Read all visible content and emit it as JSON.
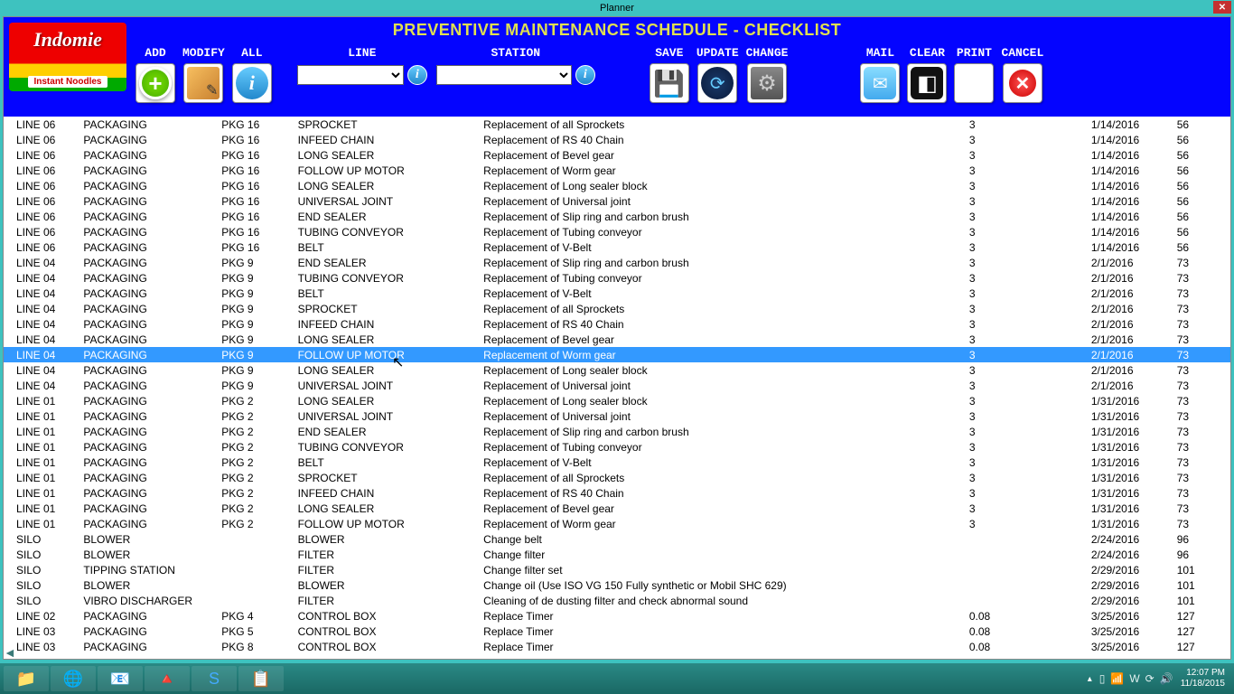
{
  "window": {
    "title": "Planner"
  },
  "header": {
    "title": "PREVENTIVE MAINTENANCE SCHEDULE - CHECKLIST"
  },
  "logo": {
    "brand": "Indomie",
    "tagline": "Instant Noodles"
  },
  "toolbar": {
    "add": "ADD",
    "modify": "MODIFY",
    "all": "ALL",
    "line": "LINE",
    "station": "STATION",
    "save": "SAVE",
    "update": "UPDATE",
    "change": "CHANGE",
    "mail": "MAIL",
    "clear": "CLEAR",
    "print": "PRINT",
    "cancel": "CANCEL"
  },
  "rows": [
    {
      "line": "LINE 06",
      "area": "PACKAGING",
      "code": "PKG 16",
      "part": "SPROCKET",
      "desc": "Replacement of all Sprockets",
      "qty": "3",
      "date": "1/14/2016",
      "days": "56"
    },
    {
      "line": "LINE 06",
      "area": "PACKAGING",
      "code": "PKG 16",
      "part": "INFEED CHAIN",
      "desc": "Replacement of RS 40 Chain",
      "qty": "3",
      "date": "1/14/2016",
      "days": "56"
    },
    {
      "line": "LINE 06",
      "area": "PACKAGING",
      "code": "PKG 16",
      "part": "LONG SEALER",
      "desc": "Replacement of Bevel gear",
      "qty": "3",
      "date": "1/14/2016",
      "days": "56"
    },
    {
      "line": "LINE 06",
      "area": "PACKAGING",
      "code": "PKG 16",
      "part": "FOLLOW UP MOTOR",
      "desc": "Replacement of Worm gear",
      "qty": "3",
      "date": "1/14/2016",
      "days": "56"
    },
    {
      "line": "LINE 06",
      "area": "PACKAGING",
      "code": "PKG 16",
      "part": "LONG SEALER",
      "desc": "Replacement of Long sealer block",
      "qty": "3",
      "date": "1/14/2016",
      "days": "56"
    },
    {
      "line": "LINE 06",
      "area": "PACKAGING",
      "code": "PKG 16",
      "part": "UNIVERSAL JOINT",
      "desc": "Replacement of Universal joint",
      "qty": "3",
      "date": "1/14/2016",
      "days": "56"
    },
    {
      "line": "LINE 06",
      "area": "PACKAGING",
      "code": "PKG 16",
      "part": "END SEALER",
      "desc": "Replacement of Slip ring and carbon brush",
      "qty": "3",
      "date": "1/14/2016",
      "days": "56"
    },
    {
      "line": "LINE 06",
      "area": "PACKAGING",
      "code": "PKG 16",
      "part": "TUBING CONVEYOR",
      "desc": "Replacement of Tubing conveyor",
      "qty": "3",
      "date": "1/14/2016",
      "days": "56"
    },
    {
      "line": "LINE 06",
      "area": "PACKAGING",
      "code": "PKG 16",
      "part": "BELT",
      "desc": "Replacement of V-Belt",
      "qty": "3",
      "date": "1/14/2016",
      "days": "56"
    },
    {
      "line": "LINE 04",
      "area": "PACKAGING",
      "code": "PKG 9",
      "part": "END SEALER",
      "desc": "Replacement of Slip ring and carbon brush",
      "qty": "3",
      "date": "2/1/2016",
      "days": "73"
    },
    {
      "line": "LINE 04",
      "area": "PACKAGING",
      "code": "PKG 9",
      "part": "TUBING CONVEYOR",
      "desc": "Replacement of Tubing conveyor",
      "qty": "3",
      "date": "2/1/2016",
      "days": "73"
    },
    {
      "line": "LINE 04",
      "area": "PACKAGING",
      "code": "PKG 9",
      "part": "BELT",
      "desc": "Replacement of V-Belt",
      "qty": "3",
      "date": "2/1/2016",
      "days": "73"
    },
    {
      "line": "LINE 04",
      "area": "PACKAGING",
      "code": "PKG 9",
      "part": "SPROCKET",
      "desc": "Replacement of all Sprockets",
      "qty": "3",
      "date": "2/1/2016",
      "days": "73"
    },
    {
      "line": "LINE 04",
      "area": "PACKAGING",
      "code": "PKG 9",
      "part": "INFEED CHAIN",
      "desc": "Replacement of RS 40 Chain",
      "qty": "3",
      "date": "2/1/2016",
      "days": "73"
    },
    {
      "line": "LINE 04",
      "area": "PACKAGING",
      "code": "PKG 9",
      "part": "LONG SEALER",
      "desc": "Replacement of Bevel gear",
      "qty": "3",
      "date": "2/1/2016",
      "days": "73"
    },
    {
      "line": "LINE 04",
      "area": "PACKAGING",
      "code": "PKG 9",
      "part": "FOLLOW UP MOTOR",
      "desc": "Replacement of Worm gear",
      "qty": "3",
      "date": "2/1/2016",
      "days": "73",
      "sel": true
    },
    {
      "line": "LINE 04",
      "area": "PACKAGING",
      "code": "PKG 9",
      "part": "LONG SEALER",
      "desc": "Replacement of Long sealer block",
      "qty": "3",
      "date": "2/1/2016",
      "days": "73"
    },
    {
      "line": "LINE 04",
      "area": "PACKAGING",
      "code": "PKG 9",
      "part": "UNIVERSAL JOINT",
      "desc": "Replacement of Universal joint",
      "qty": "3",
      "date": "2/1/2016",
      "days": "73"
    },
    {
      "line": "LINE 01",
      "area": "PACKAGING",
      "code": "PKG 2",
      "part": "LONG SEALER",
      "desc": "Replacement of Long sealer block",
      "qty": "3",
      "date": "1/31/2016",
      "days": "73"
    },
    {
      "line": "LINE 01",
      "area": "PACKAGING",
      "code": "PKG 2",
      "part": "UNIVERSAL JOINT",
      "desc": "Replacement of Universal joint",
      "qty": "3",
      "date": "1/31/2016",
      "days": "73"
    },
    {
      "line": "LINE 01",
      "area": "PACKAGING",
      "code": "PKG 2",
      "part": "END SEALER",
      "desc": "Replacement of Slip ring and carbon brush",
      "qty": "3",
      "date": "1/31/2016",
      "days": "73"
    },
    {
      "line": "LINE 01",
      "area": "PACKAGING",
      "code": "PKG 2",
      "part": "TUBING CONVEYOR",
      "desc": "Replacement of Tubing conveyor",
      "qty": "3",
      "date": "1/31/2016",
      "days": "73"
    },
    {
      "line": "LINE 01",
      "area": "PACKAGING",
      "code": "PKG 2",
      "part": "BELT",
      "desc": "Replacement of V-Belt",
      "qty": "3",
      "date": "1/31/2016",
      "days": "73"
    },
    {
      "line": "LINE 01",
      "area": "PACKAGING",
      "code": "PKG 2",
      "part": "SPROCKET",
      "desc": "Replacement of all Sprockets",
      "qty": "3",
      "date": "1/31/2016",
      "days": "73"
    },
    {
      "line": "LINE 01",
      "area": "PACKAGING",
      "code": "PKG 2",
      "part": "INFEED CHAIN",
      "desc": "Replacement of RS 40 Chain",
      "qty": "3",
      "date": "1/31/2016",
      "days": "73"
    },
    {
      "line": "LINE 01",
      "area": "PACKAGING",
      "code": "PKG 2",
      "part": "LONG SEALER",
      "desc": "Replacement of Bevel gear",
      "qty": "3",
      "date": "1/31/2016",
      "days": "73"
    },
    {
      "line": "LINE 01",
      "area": "PACKAGING",
      "code": "PKG 2",
      "part": "FOLLOW UP MOTOR",
      "desc": "Replacement of Worm gear",
      "qty": "3",
      "date": "1/31/2016",
      "days": "73"
    },
    {
      "line": "SILO",
      "area": "BLOWER",
      "code": "",
      "part": "BLOWER",
      "desc": "Change belt",
      "qty": "",
      "date": "2/24/2016",
      "days": "96"
    },
    {
      "line": "SILO",
      "area": "BLOWER",
      "code": "",
      "part": "FILTER",
      "desc": "Change filter",
      "qty": "",
      "date": "2/24/2016",
      "days": "96"
    },
    {
      "line": "SILO",
      "area": "TIPPING STATION",
      "code": "",
      "part": "FILTER",
      "desc": "Change filter set",
      "qty": "",
      "date": "2/29/2016",
      "days": "101"
    },
    {
      "line": "SILO",
      "area": "BLOWER",
      "code": "",
      "part": "BLOWER",
      "desc": "Change oil (Use ISO VG 150 Fully synthetic or Mobil SHC 629)",
      "qty": "",
      "date": "2/29/2016",
      "days": "101"
    },
    {
      "line": "SILO",
      "area": "VIBRO DISCHARGER",
      "code": "",
      "part": "FILTER",
      "desc": "Cleaning of de dusting filter and check abnormal sound",
      "qty": "",
      "date": "2/29/2016",
      "days": "101"
    },
    {
      "line": "LINE 02",
      "area": "PACKAGING",
      "code": "PKG 4",
      "part": "CONTROL BOX",
      "desc": "Replace Timer",
      "qty": "0.08",
      "date": "3/25/2016",
      "days": "127"
    },
    {
      "line": "LINE 03",
      "area": "PACKAGING",
      "code": "PKG 5",
      "part": "CONTROL BOX",
      "desc": "Replace Timer",
      "qty": "0.08",
      "date": "3/25/2016",
      "days": "127"
    },
    {
      "line": "LINE 03",
      "area": "PACKAGING",
      "code": "PKG 8",
      "part": "CONTROL BOX",
      "desc": "Replace Timer",
      "qty": "0.08",
      "date": "3/25/2016",
      "days": "127"
    }
  ],
  "tray": {
    "time": "12:07 PM",
    "date": "11/18/2015"
  }
}
